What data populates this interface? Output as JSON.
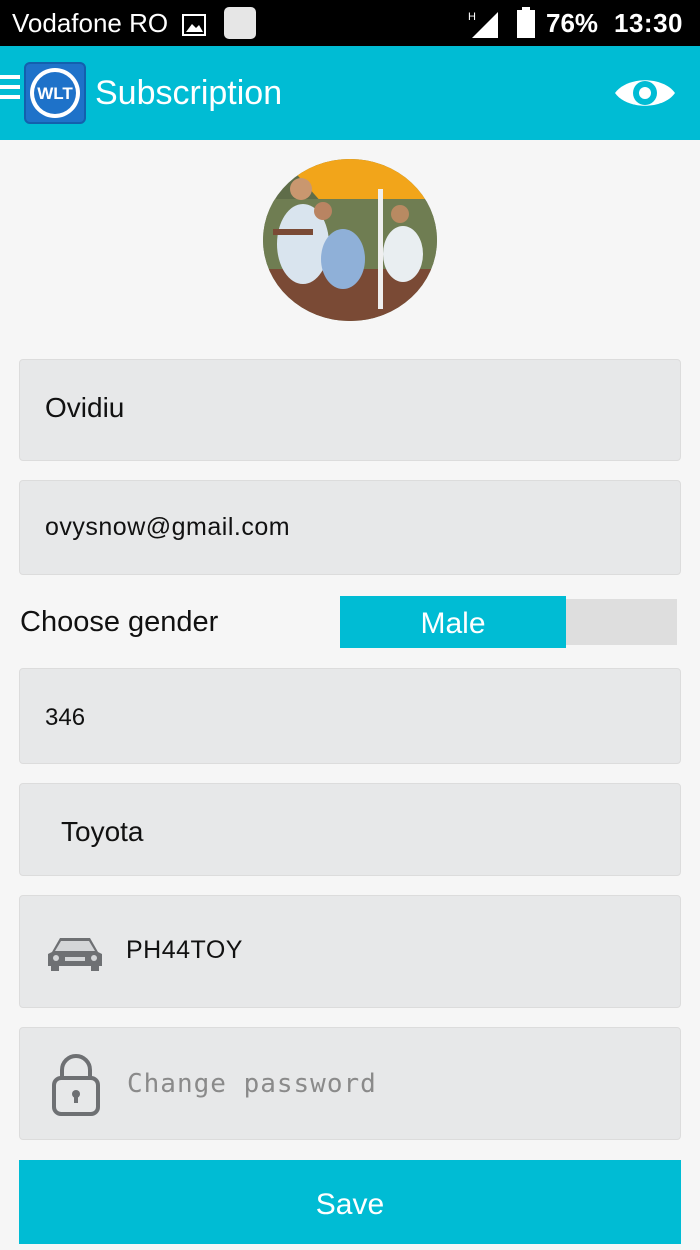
{
  "status_bar": {
    "carrier": "Vodafone RO",
    "network": "H",
    "battery": "76%",
    "time": "13:30"
  },
  "app_bar": {
    "logo_text": "WLT",
    "title": "Subscription",
    "accent_color": "#00bcd4",
    "icons": [
      "menu-icon",
      "eye-icon"
    ]
  },
  "form": {
    "name": "Ovidiu",
    "email": "ovysnow@gmail.com",
    "gender_label": "Choose gender",
    "gender_selected": "Male",
    "number": "346",
    "car_brand": "Toyota",
    "plate": "PH44TOY",
    "password_placeholder": "Change password"
  },
  "actions": {
    "save_label": "Save"
  }
}
